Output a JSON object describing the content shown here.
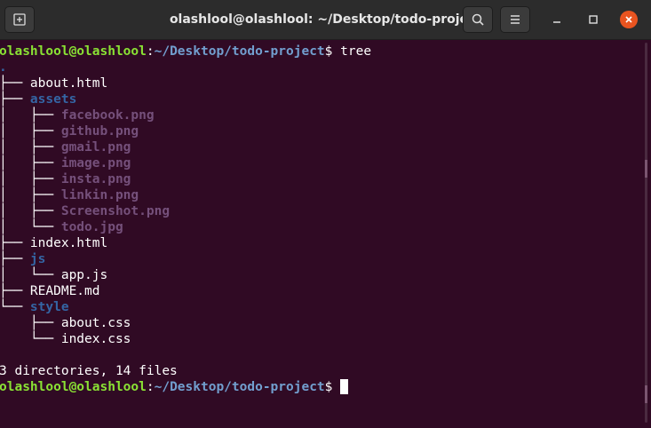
{
  "window": {
    "title": "olashlool@olashlool: ~/Desktop/todo-project"
  },
  "icons": {
    "new_tab": "new-tab-icon",
    "search": "search-icon",
    "menu": "hamburger-menu-icon",
    "minimize": "minimize-icon",
    "maximize": "maximize-icon",
    "close": "close-icon"
  },
  "colors": {
    "background": "#300a24",
    "prompt_user": "#8ae234",
    "prompt_path": "#729fcf",
    "directory": "#3465a4",
    "image_file": "#75507b",
    "close_button": "#e95420"
  },
  "terminal": {
    "prompt1": {
      "user": "olashlool@olashlool",
      "sep": ":",
      "path": "~/Desktop/todo-project",
      "sym": "$ ",
      "cmd": "tree"
    },
    "root": ".",
    "lines": [
      {
        "prefix": "├── ",
        "name": "about.html",
        "kind": "white"
      },
      {
        "prefix": "├── ",
        "name": "assets",
        "kind": "dir"
      },
      {
        "prefix": "│   ├── ",
        "name": "facebook.png",
        "kind": "img"
      },
      {
        "prefix": "│   ├── ",
        "name": "github.png",
        "kind": "img"
      },
      {
        "prefix": "│   ├── ",
        "name": "gmail.png",
        "kind": "img"
      },
      {
        "prefix": "│   ├── ",
        "name": "image.png",
        "kind": "img"
      },
      {
        "prefix": "│   ├── ",
        "name": "insta.png",
        "kind": "img"
      },
      {
        "prefix": "│   ├── ",
        "name": "linkin.png",
        "kind": "img"
      },
      {
        "prefix": "│   ├── ",
        "name": "Screenshot.png",
        "kind": "img"
      },
      {
        "prefix": "│   └── ",
        "name": "todo.jpg",
        "kind": "img"
      },
      {
        "prefix": "├── ",
        "name": "index.html",
        "kind": "white"
      },
      {
        "prefix": "├── ",
        "name": "js",
        "kind": "dir"
      },
      {
        "prefix": "│   └── ",
        "name": "app.js",
        "kind": "white"
      },
      {
        "prefix": "├── ",
        "name": "README.md",
        "kind": "white"
      },
      {
        "prefix": "└── ",
        "name": "style",
        "kind": "dir"
      },
      {
        "prefix": "    ├── ",
        "name": "about.css",
        "kind": "white"
      },
      {
        "prefix": "    └── ",
        "name": "index.css",
        "kind": "white"
      }
    ],
    "summary": "3 directories, 14 files",
    "prompt2": {
      "user": "olashlool@olashlool",
      "sep": ":",
      "path": "~/Desktop/todo-project",
      "sym": "$"
    }
  }
}
